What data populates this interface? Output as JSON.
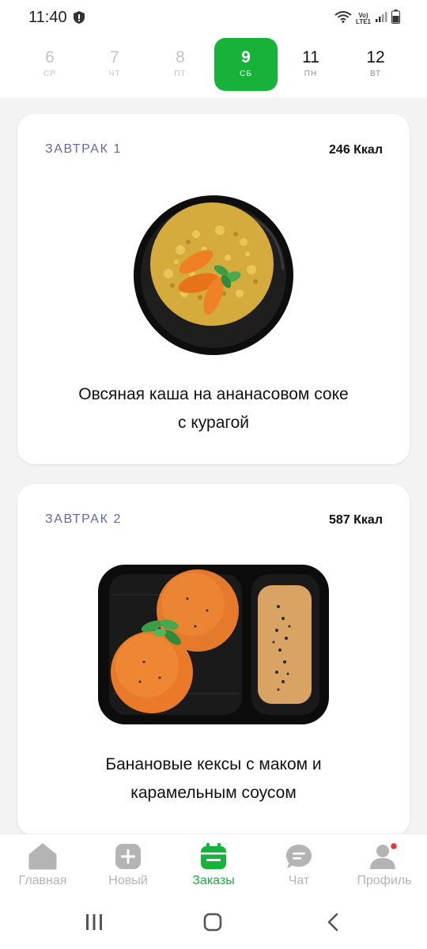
{
  "status_bar": {
    "time": "11:40",
    "network_label_top": "Vo)",
    "network_label_bottom": "LTE1"
  },
  "date_strip": {
    "days": [
      {
        "number": "6",
        "weekday": "СР",
        "state": "past"
      },
      {
        "number": "7",
        "weekday": "ЧТ",
        "state": "past"
      },
      {
        "number": "8",
        "weekday": "ПТ",
        "state": "past"
      },
      {
        "number": "9",
        "weekday": "СБ",
        "state": "active"
      },
      {
        "number": "11",
        "weekday": "ПН",
        "state": "future"
      },
      {
        "number": "12",
        "weekday": "ВТ",
        "state": "future"
      }
    ]
  },
  "meals": [
    {
      "label": "ЗАВТРАК 1",
      "kcal": "246 Ккал",
      "name_line1": "Овсяная каша на ананасовом соке",
      "name_line2": "с курагой",
      "image": "oatmeal-bowl"
    },
    {
      "label": "ЗАВТРАК 2",
      "kcal": "587 Ккал",
      "name_line1": "Банановые кексы с маком и",
      "name_line2": "карамельным соусом",
      "image": "banana-muffins-tray"
    }
  ],
  "bottom_nav": {
    "items": [
      {
        "label": "Главная",
        "icon": "home-icon"
      },
      {
        "label": "Новый",
        "icon": "plus-icon"
      },
      {
        "label": "Заказы",
        "icon": "calendar-icon",
        "active": true
      },
      {
        "label": "Чат",
        "icon": "chat-icon"
      },
      {
        "label": "Профиль",
        "icon": "profile-icon"
      }
    ]
  },
  "colors": {
    "accent": "#17b23a",
    "meal_label": "#5f6aa7",
    "inactive": "#b4b4b4",
    "notification_dot": "#e53935"
  }
}
